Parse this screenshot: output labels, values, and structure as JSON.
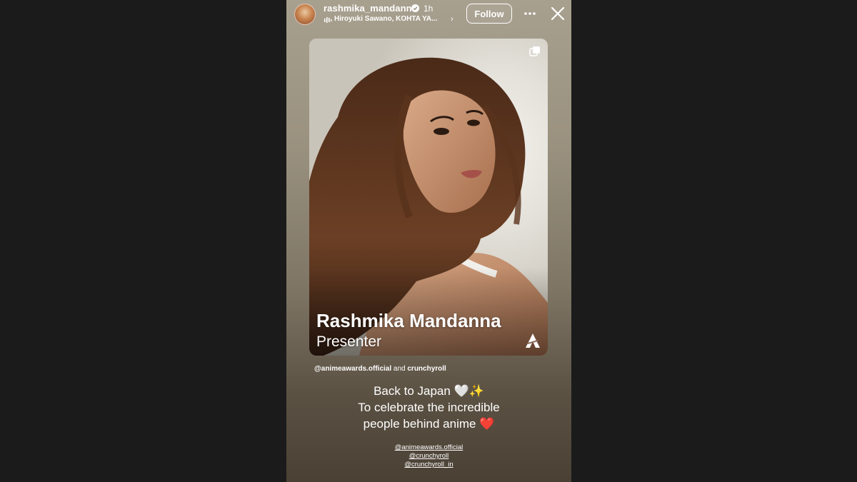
{
  "story": {
    "username": "rashmika_mandanna",
    "time": "1h",
    "music": "Hiroyuki Sawano, KOHTA YA...",
    "follow_label": "Follow",
    "icons": {
      "avatar": "profile-avatar",
      "verified": "verified-badge-icon",
      "music": "music-bars-icon",
      "chevron": "chevron-right-icon",
      "more": "more-icon",
      "close": "close-icon",
      "multi": "multi-image-icon",
      "logo": "anime-awards-logo"
    }
  },
  "card": {
    "name": "Rashmika Mandanna",
    "role": "Presenter"
  },
  "collab": {
    "account1": "@animeawards.official",
    "and": "and",
    "account2": "crunchyroll"
  },
  "caption": {
    "line1": "Back to Japan 🤍✨",
    "line2": "To celebrate the incredible",
    "line3": "people behind anime ❤️"
  },
  "mentions": [
    "@animeawards.official",
    "@crunchyroll",
    "@crunchyroll_in"
  ]
}
